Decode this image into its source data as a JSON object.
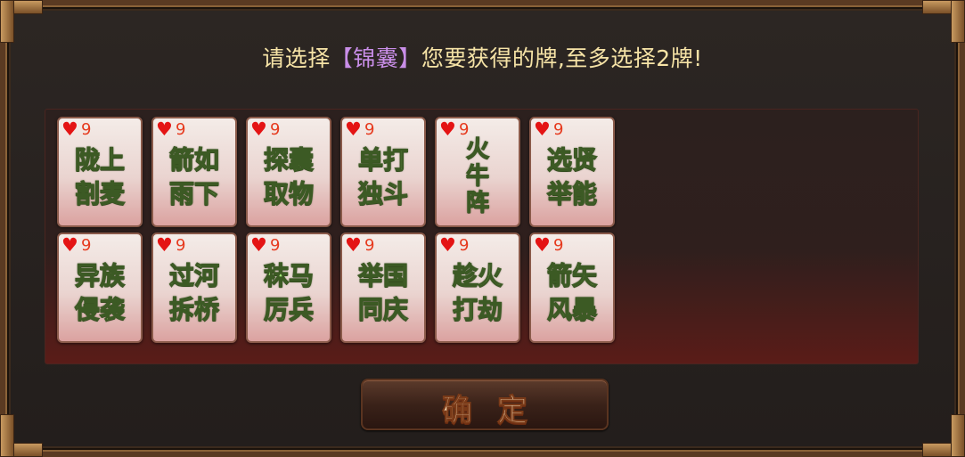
{
  "prompt": {
    "before": "请选择",
    "highlight": "【锦囊】",
    "after": "您要获得的牌,至多选择2牌!"
  },
  "cards": [
    {
      "suit": "♥",
      "rank": "9",
      "lines": [
        "陇上",
        "割麦"
      ]
    },
    {
      "suit": "♥",
      "rank": "9",
      "lines": [
        "箭如",
        "雨下"
      ]
    },
    {
      "suit": "♥",
      "rank": "9",
      "lines": [
        "探囊",
        "取物"
      ]
    },
    {
      "suit": "♥",
      "rank": "9",
      "lines": [
        "单打",
        "独斗"
      ]
    },
    {
      "suit": "♥",
      "rank": "9",
      "lines": [
        "火",
        "牛",
        "阵"
      ]
    },
    {
      "suit": "♥",
      "rank": "9",
      "lines": [
        "选贤",
        "举能"
      ]
    },
    {
      "suit": "♥",
      "rank": "9",
      "lines": [
        "异族",
        "侵袭"
      ]
    },
    {
      "suit": "♥",
      "rank": "9",
      "lines": [
        "过河",
        "拆桥"
      ]
    },
    {
      "suit": "♥",
      "rank": "9",
      "lines": [
        "秣马",
        "厉兵"
      ]
    },
    {
      "suit": "♥",
      "rank": "9",
      "lines": [
        "举国",
        "同庆"
      ]
    },
    {
      "suit": "♥",
      "rank": "9",
      "lines": [
        "趁火",
        "打劫"
      ]
    },
    {
      "suit": "♥",
      "rank": "9",
      "lines": [
        "箭矢",
        "风暴"
      ]
    }
  ],
  "confirm_button": {
    "label": "确定"
  },
  "colors": {
    "prompt_text": "#f6e3a6",
    "prompt_highlight": "#c98ee8",
    "suit_red": "#e41414",
    "card_name_green": "#a6e87c"
  }
}
